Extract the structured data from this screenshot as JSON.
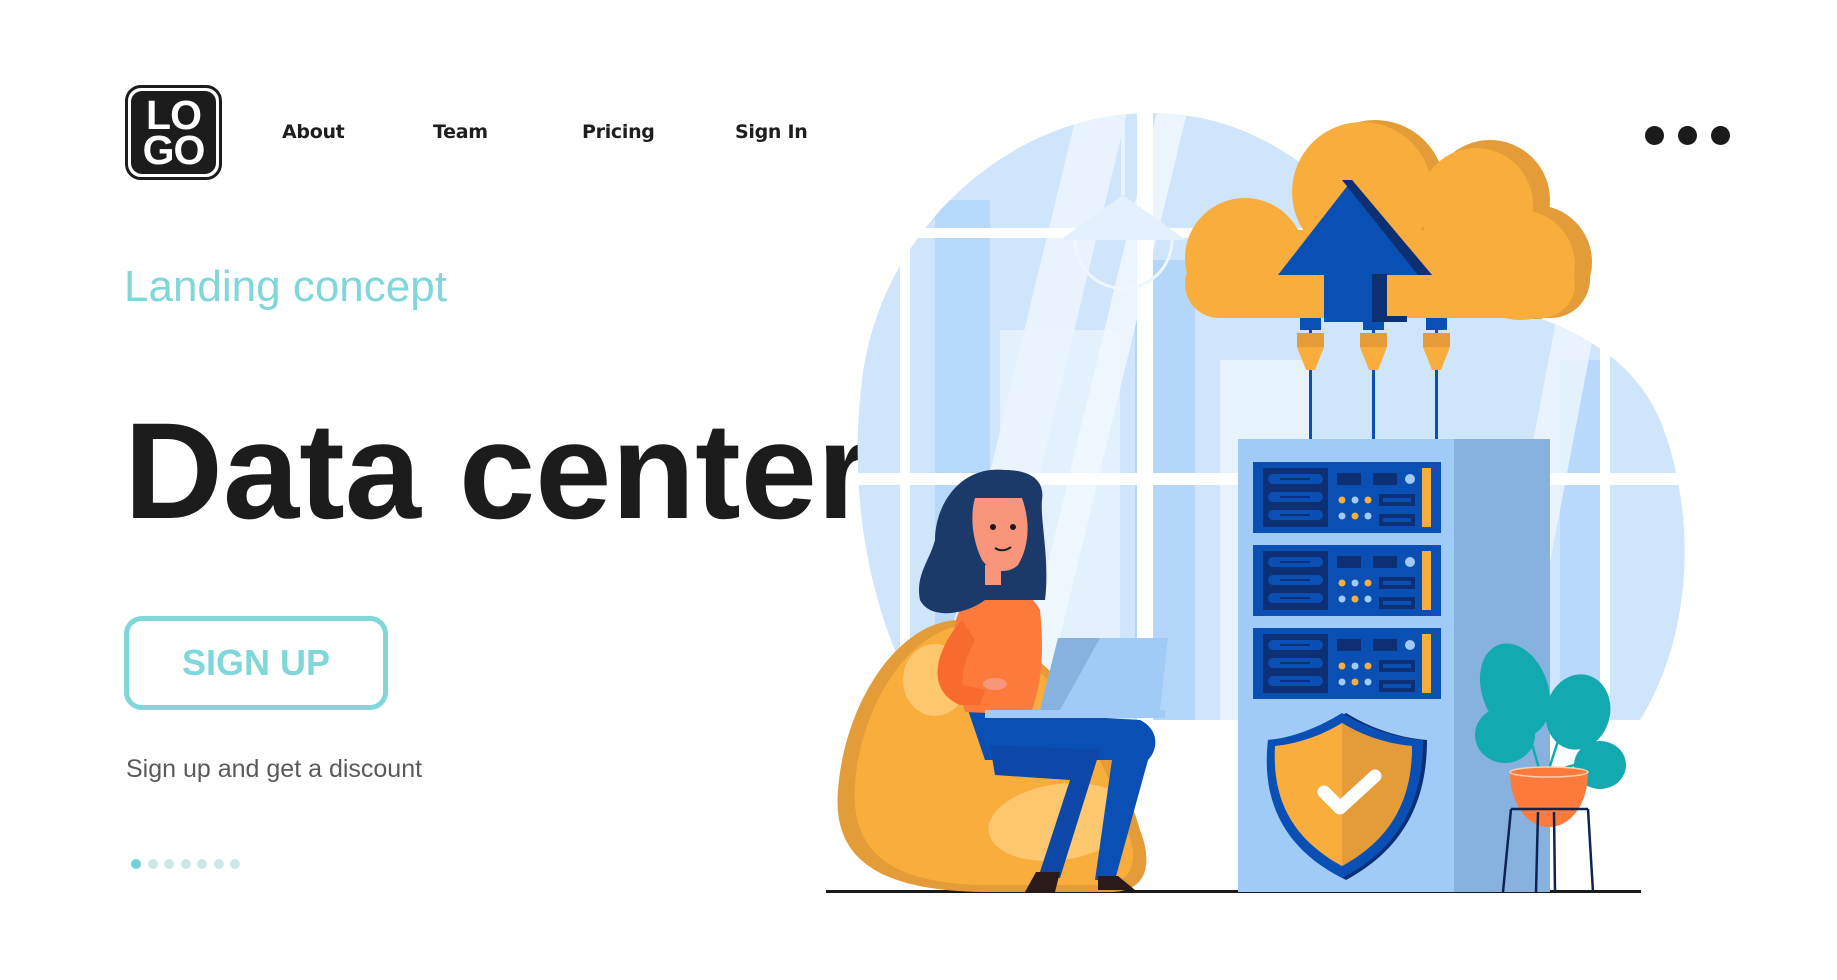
{
  "header": {
    "logo": {
      "line1": "LO",
      "line2": "GO"
    },
    "nav": [
      {
        "label": "About"
      },
      {
        "label": "Team"
      },
      {
        "label": "Pricing"
      },
      {
        "label": "Sign In"
      }
    ],
    "more_icon": "more-horizontal-icon"
  },
  "hero": {
    "eyebrow": "Landing concept",
    "title": "Data center",
    "cta_label": "SIGN UP",
    "subtext": "Sign up and get a discount"
  },
  "pager": {
    "total": 7,
    "active_index": 0
  },
  "illustration": {
    "subject": "Woman on bean bag with laptop beside server rack uploading to cloud",
    "icons": [
      "cloud-upload-icon",
      "server-rack-icon",
      "shield-check-icon",
      "plant-icon",
      "laptop-icon"
    ]
  },
  "colors": {
    "accent": "#7fd7da",
    "text_dark": "#1c1c1c",
    "text_muted": "#5a5a5a",
    "cloud": "#f9ad3d",
    "server_blue": "#0a4fb3",
    "server_panel": "#9fcbf6"
  }
}
